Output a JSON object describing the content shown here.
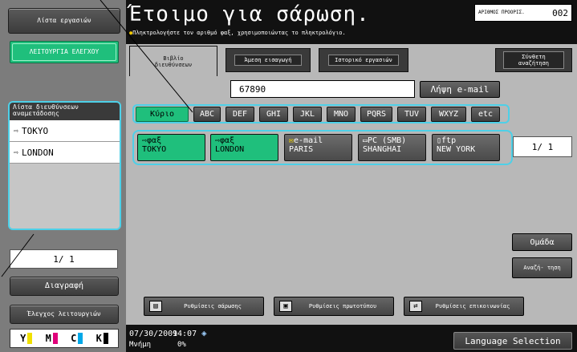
{
  "title": {
    "main": "Έτοιμο για σάρωση.",
    "sub": "Πληκτρολογήστε τον αριθμό φαξ, χρησιμοποιώντας το πληκτρολόγιο."
  },
  "counter": {
    "label": "ΑΡΙΘΜΟΣ ΠΡΟΟΡΙΣ.",
    "value": "002"
  },
  "left": {
    "jobs_label": "Λίστα εργασιών",
    "control_label": "ΛΕΙΤΟΥΡΓΙΑ ΕΛΕΓΧΟΥ",
    "dest_list_header": "Λίστα διευθύνσεων αναμετάδοσης",
    "dest_items": [
      "TOKYO",
      "LONDON"
    ],
    "page": "1/  1",
    "delete_label": "Διαγραφή",
    "check_label": "Έλεγχος λειτουργιών",
    "toner": [
      "Y",
      "M",
      "C",
      "K"
    ]
  },
  "tabs": {
    "addressbook": "Βιβλίο διευθύνσεων",
    "direct": "Άμεση εισαγωγή",
    "history": "Ιστορικό εργασιών",
    "search": "Σύνθετη αναζήτηση"
  },
  "input": {
    "value": "67890",
    "email_button": "Λήψη e-mail"
  },
  "index": [
    "Κύριο",
    "ABC",
    "DEF",
    "GHI",
    "JKL",
    "MNO",
    "PQRS",
    "TUV",
    "WXYZ",
    "etc"
  ],
  "destinations": [
    {
      "type": "φαξ",
      "name": "TOKYO"
    },
    {
      "type": "φαξ",
      "name": "LONDON"
    },
    {
      "type": "e-mail",
      "name": "PARIS"
    },
    {
      "type": "PC (SMB)",
      "name": "SHANGHAI"
    },
    {
      "type": "ftp",
      "name": "NEW YORK"
    }
  ],
  "page_right": "1/  1",
  "group_label": "Ομάδα",
  "search_label": "Αναζή- τηση",
  "settings": {
    "scan": "Ρυθμίσεις σάρωσης",
    "original": "Ρυθμίσεις πρωτοτύπου",
    "comm": "Ρυθμίσεις επικοινωνίας"
  },
  "status": {
    "date": "07/30/2009",
    "time": "14:07",
    "memory_label": "Μνήμη",
    "memory_value": "0%",
    "language_button": "Language Selection"
  },
  "colors": {
    "accent": "#1fbf7c",
    "highlight": "#4dd0e8",
    "toner_y": "#f0e000",
    "toner_m": "#e0007a",
    "toner_c": "#00a8e8",
    "toner_k": "#000000"
  }
}
